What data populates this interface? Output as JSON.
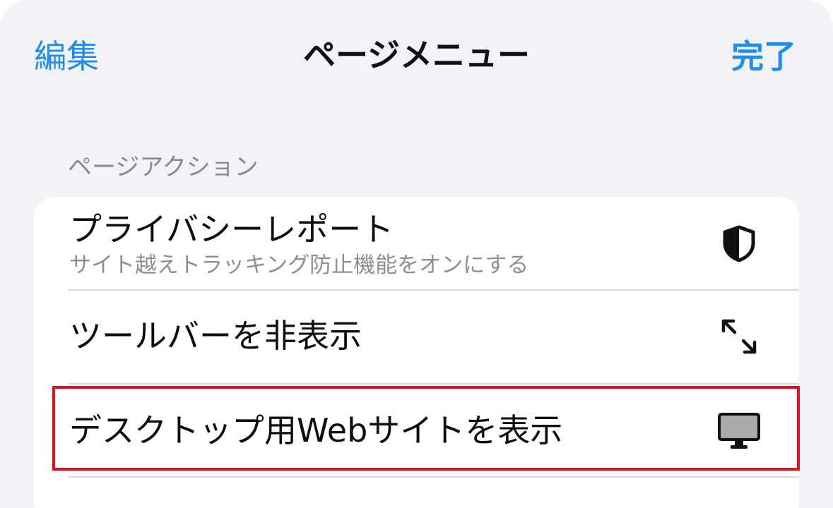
{
  "nav": {
    "edit_label": "編集",
    "title": "ページメニュー",
    "done_label": "完了"
  },
  "section": {
    "header": "ページアクション"
  },
  "items": [
    {
      "title": "プライバシーレポート",
      "subtitle": "サイト越えトラッキング防止機能をオンにする",
      "icon": "shield-icon"
    },
    {
      "title": "ツールバーを非表示",
      "icon": "expand-arrows-icon"
    },
    {
      "title": "デスクトップ用Webサイトを表示",
      "icon": "desktop-icon",
      "highlighted": true
    }
  ],
  "colors": {
    "accent": "#1c8ef0",
    "highlight_border": "#e0101f",
    "background": "#f2f2f7"
  }
}
